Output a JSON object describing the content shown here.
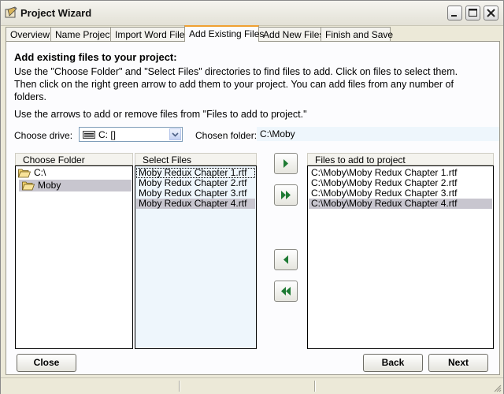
{
  "window": {
    "title": "Project Wizard"
  },
  "tabs": [
    {
      "label": "Overview"
    },
    {
      "label": "Name Project"
    },
    {
      "label": "Import Word Files"
    },
    {
      "label": "Add Existing Files"
    },
    {
      "label": "Add New Files"
    },
    {
      "label": "Finish and Save"
    }
  ],
  "active_tab": "Add Existing Files",
  "main": {
    "heading": "Add existing files to your project:",
    "instructions_1": "Use the \"Choose Folder\" and \"Select Files\" directories to find files to add.  Click on files to select them.",
    "instructions_2": "Then click on the right green arrow to add them to your project.  You can add files from any number of",
    "instructions_3": "folders.",
    "instructions_4": "Use the arrows to add or remove files from \"Files to add to project.\""
  },
  "drive": {
    "label": "Choose drive:",
    "value": "C: []"
  },
  "folder": {
    "label": "Chosen folder:",
    "value": "C:\\Moby"
  },
  "choose_folder": {
    "header": "Choose Folder",
    "items": [
      {
        "label": "C:\\",
        "selected": false
      },
      {
        "label": "Moby",
        "selected": true
      }
    ]
  },
  "select_files": {
    "header": "Select Files",
    "items": [
      {
        "label": "Moby Redux Chapter 1.rtf",
        "selected": false
      },
      {
        "label": "Moby Redux Chapter 2.rtf",
        "selected": false
      },
      {
        "label": "Moby Redux Chapter 3.rtf",
        "selected": false
      },
      {
        "label": "Moby Redux Chapter 4.rtf",
        "selected": true
      }
    ]
  },
  "project_files": {
    "header": "Files to add to project",
    "items": [
      {
        "label": "C:\\Moby\\Moby Redux Chapter 1.rtf",
        "selected": false
      },
      {
        "label": "C:\\Moby\\Moby Redux Chapter 2.rtf",
        "selected": false
      },
      {
        "label": "C:\\Moby\\Moby Redux Chapter 3.rtf",
        "selected": false
      },
      {
        "label": "C:\\Moby\\Moby Redux Chapter 4.rtf",
        "selected": true
      }
    ]
  },
  "buttons": {
    "close": "Close",
    "back": "Back",
    "next": "Next"
  },
  "icons": {
    "add": "arrow-right-icon",
    "add_all": "double-arrow-right-icon",
    "remove": "arrow-left-icon",
    "remove_all": "double-arrow-left-icon"
  },
  "colors": {
    "arrow": "#1e7a33",
    "selection": "#c8c6cf",
    "active_tab_accent": "#f0a030"
  }
}
